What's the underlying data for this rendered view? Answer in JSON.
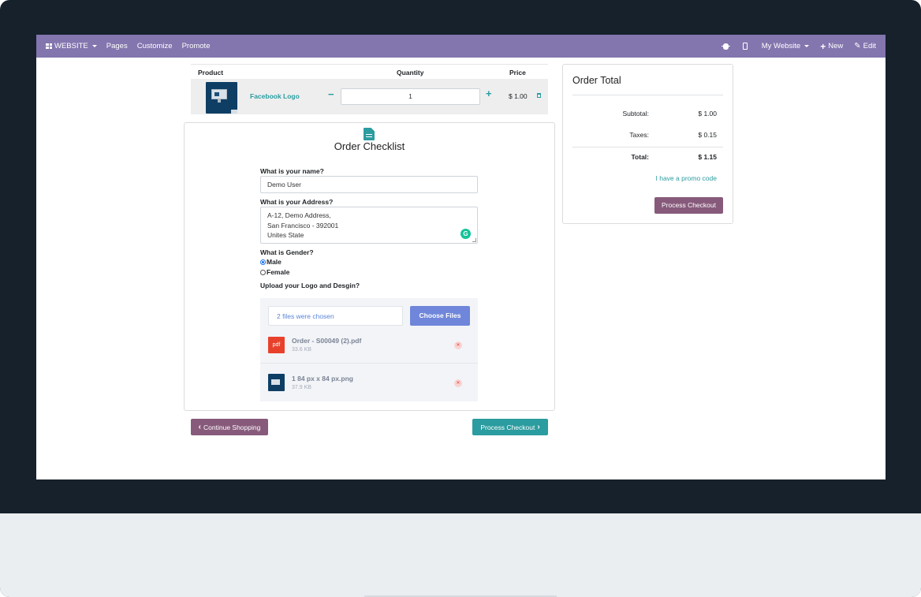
{
  "navbar": {
    "website_label": "WEBSITE",
    "pages": "Pages",
    "customize": "Customize",
    "promote": "Promote",
    "site_selector": "My Website",
    "new_label": "New",
    "edit_label": "Edit"
  },
  "cart": {
    "headers": {
      "product": "Product",
      "quantity": "Quantity",
      "price": "Price"
    },
    "items": [
      {
        "name": "Facebook Logo",
        "quantity": "1",
        "price": "$ 1.00"
      }
    ]
  },
  "checklist": {
    "title": "Order Checklist",
    "name_label": "What is your name?",
    "name_value": "Demo User",
    "address_label": "What is your Address?",
    "address_lines": [
      "A-12, Demo Address,",
      "San Francisco - 392001",
      "Unites State"
    ],
    "gender_label": "What is Gender?",
    "gender_options": [
      "Male",
      "Female"
    ],
    "gender_selected": "Male",
    "upload_label": "Upload your Logo and Desgin?",
    "files_chosen": "2 files were chosen",
    "choose_button": "Choose Files",
    "files": [
      {
        "name": "Order - S00049 (2).pdf",
        "size": "33.6 KB",
        "type_label": "pdf"
      },
      {
        "name": "1 84 px x 84 px.png",
        "size": "37.9 KB"
      }
    ]
  },
  "buttons": {
    "continue": "Continue Shopping",
    "process": "Process Checkout"
  },
  "order_total": {
    "title": "Order Total",
    "subtotal_label": "Subtotal:",
    "subtotal_value": "$ 1.00",
    "taxes_label": "Taxes:",
    "taxes_value": "$ 0.15",
    "total_label": "Total:",
    "total_value": "$ 1.15",
    "promo_link": "I have a promo code",
    "process_button": "Process Checkout"
  },
  "colors": {
    "navbar": "#8375ae",
    "primary": "#875a7b",
    "accent": "#2b9c9f",
    "upload_button": "#6f86da",
    "pdf": "#e8412b"
  }
}
